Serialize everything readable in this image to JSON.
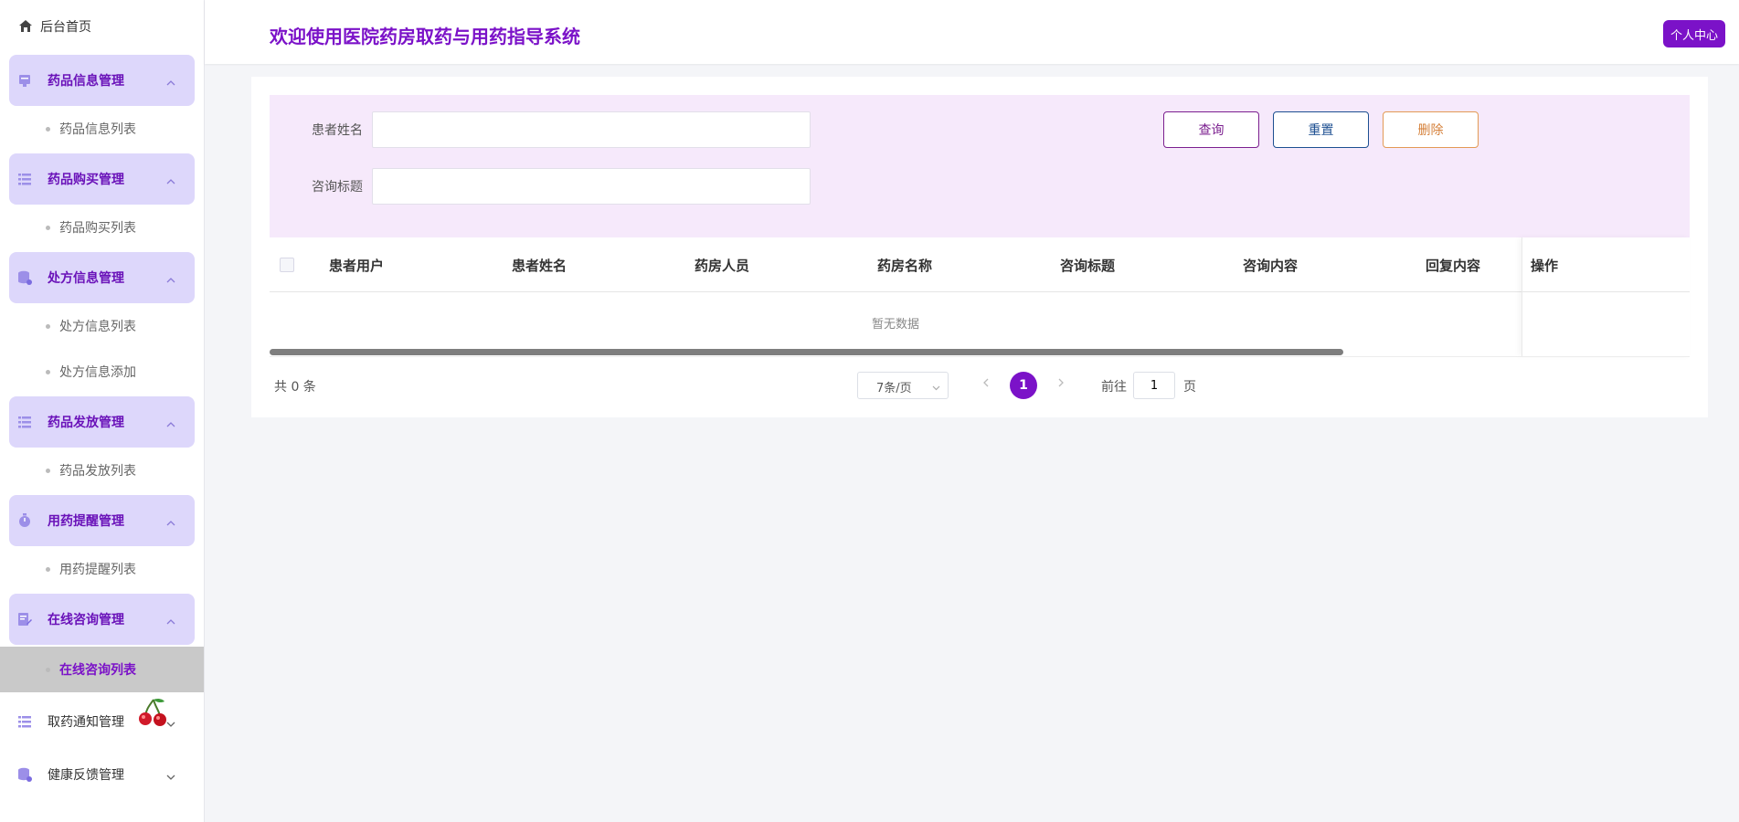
{
  "sidebar": {
    "home_label": "后台首页",
    "groups": [
      {
        "label": "药品信息管理",
        "icon": "monitor-icon",
        "items": [
          "药品信息列表"
        ]
      },
      {
        "label": "药品购买管理",
        "icon": "list-icon",
        "items": [
          "药品购买列表"
        ]
      },
      {
        "label": "处方信息管理",
        "icon": "database-icon",
        "items": [
          "处方信息列表",
          "处方信息添加"
        ]
      },
      {
        "label": "药品发放管理",
        "icon": "list-icon",
        "items": [
          "药品发放列表"
        ]
      },
      {
        "label": "用药提醒管理",
        "icon": "timer-icon",
        "items": [
          "用药提醒列表"
        ]
      },
      {
        "label": "在线咨询管理",
        "icon": "edit-doc-icon",
        "items": [
          "在线咨询列表"
        ]
      },
      {
        "label": "取药通知管理",
        "icon": "list-icon",
        "items": []
      },
      {
        "label": "健康反馈管理",
        "icon": "database-icon",
        "items": []
      }
    ],
    "active_item": "在线咨询列表"
  },
  "header": {
    "title": "欢迎使用医院药房取药与用药指导系统",
    "user_button": "个人中心"
  },
  "search": {
    "field1_label": "患者姓名",
    "field1_value": "",
    "field2_label": "咨询标题",
    "field2_value": "",
    "query_button": "查询",
    "reset_button": "重置",
    "delete_button": "删除"
  },
  "table": {
    "columns": [
      "患者用户",
      "患者姓名",
      "药房人员",
      "药房名称",
      "咨询标题",
      "咨询内容",
      "回复内容",
      "操作"
    ],
    "empty_text": "暂无数据"
  },
  "pagination": {
    "total": "共 0 条",
    "page_size": "7条/页",
    "current_page": "1",
    "goto_label": "前往",
    "goto_value": "1",
    "page_unit": "页"
  },
  "colors": {
    "accent": "#7b12c8",
    "search_bg": "#f6e9fb",
    "group_bg": "#ddd7fb"
  }
}
